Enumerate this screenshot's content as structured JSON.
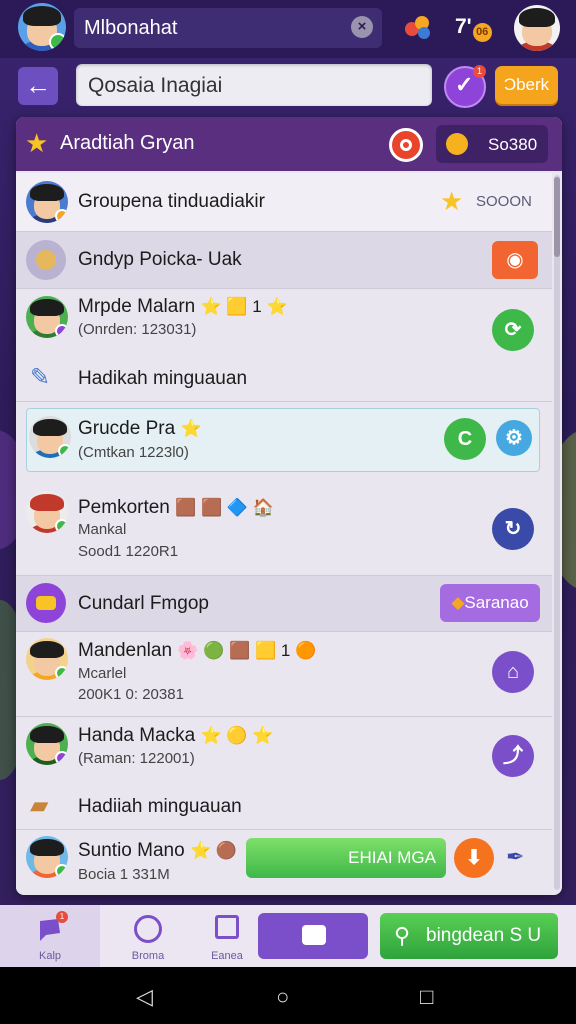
{
  "top_bar": {
    "search_value": "Mlbonahat",
    "clear_icon": "x-icon",
    "score": "7'",
    "score_coin": "06"
  },
  "secondary_bar": {
    "back_icon": "arrow-left-icon",
    "group_input_value": "Qosaia Inagiai",
    "badge_count": "1",
    "orange_label": "Ɔberk"
  },
  "panel": {
    "title": "Aradtiah Gryan",
    "coin_value": "So380",
    "rows": [
      {
        "type": "group",
        "name": "Groupena tinduadiakir",
        "action_label": "SOOON"
      },
      {
        "type": "group",
        "name": "Gndyp Poicka- Uak"
      },
      {
        "type": "member",
        "name": "Mrpde Malarn",
        "emojis": "⭐ 🟨 1 ⭐",
        "sub": "(Onrden: 123031)"
      },
      {
        "type": "section",
        "name": "Hadikah minguauan"
      },
      {
        "type": "member",
        "name": "Grucde Pra",
        "emojis": "⭐",
        "sub": "(Cmtkan 1223Ɩ0)"
      },
      {
        "type": "member3",
        "name": "Pemkorten",
        "emojis": "🟫 🟫 🔷 🏠",
        "sub": "Mankal",
        "sub2": "Sood1 1220R1"
      },
      {
        "type": "group",
        "name": "Cundarl Fmgop",
        "action_label": "Saranao"
      },
      {
        "type": "member3",
        "name": "Mandenlan",
        "emojis": "🌸 🟢 🟫 🟨 1 🟠",
        "sub": "Mcarlel",
        "sub2": "200K1 0: 20381"
      },
      {
        "type": "member",
        "name": "Handa Macka",
        "emojis": "⭐ 🟡 ⭐",
        "sub": "(Raman: 122001)"
      },
      {
        "type": "section",
        "name": "Hadiiah minguauan"
      },
      {
        "type": "member",
        "name": "Suntio Mano",
        "emojis": "⭐ 🟤",
        "sub": "Bocia 1 331M",
        "action_label": "EHIAI MGA"
      }
    ]
  },
  "bottom_nav": {
    "tabs": [
      {
        "label": "Kalp"
      },
      {
        "label": "Broma"
      },
      {
        "label": "Eanea"
      },
      {
        "label": ""
      }
    ],
    "cta_label": "bingdean S U",
    "badge": "1"
  },
  "colors": {
    "brand_purple": "#5b2f80",
    "accent_green": "#3fb84a",
    "accent_orange": "#f5a41e",
    "accent_blue": "#3a4aa8"
  }
}
